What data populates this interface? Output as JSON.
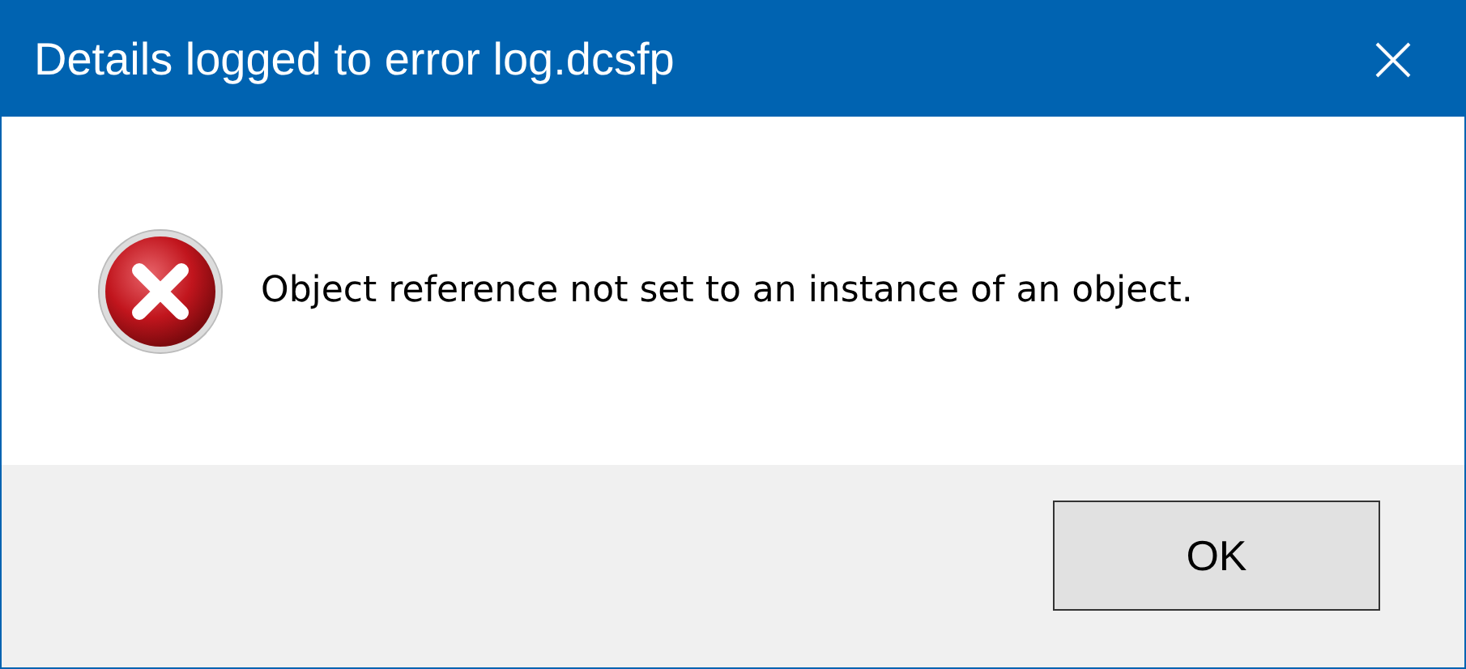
{
  "window": {
    "title": "Details logged to error log.dcsfp"
  },
  "message": "Object reference not set to an instance of an object.",
  "buttons": [
    "OK"
  ]
}
